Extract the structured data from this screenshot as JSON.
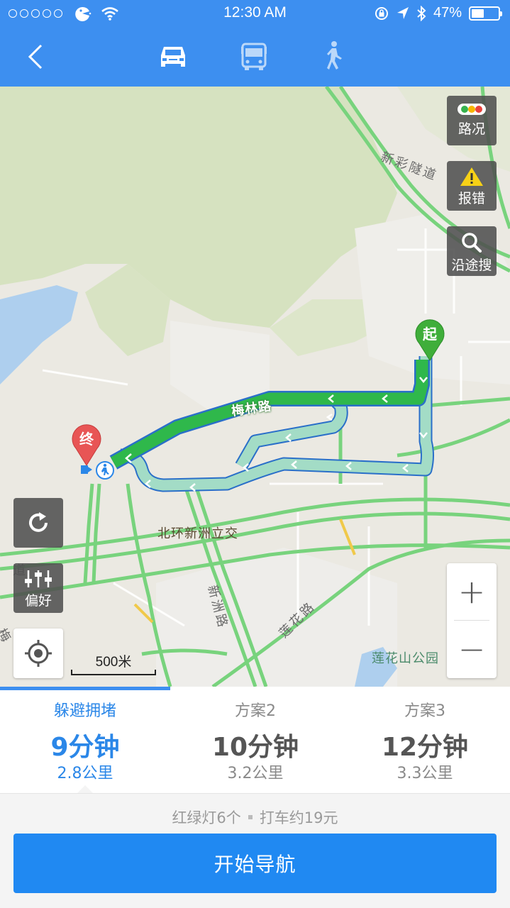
{
  "status_bar": {
    "time": "12:30 AM",
    "battery_percent": "47%",
    "battery_level": 0.47,
    "signal_dots": 5,
    "icons": [
      "signal-dots-icon",
      "carrier-logo-icon",
      "wifi-icon",
      "rotation-lock-icon",
      "location-arrow-icon",
      "bluetooth-icon",
      "battery-icon"
    ]
  },
  "nav": {
    "back_icon": "chevron-left-icon",
    "modes": [
      {
        "name": "car",
        "icon": "car-icon",
        "selected": true
      },
      {
        "name": "bus",
        "icon": "bus-icon",
        "selected": false
      },
      {
        "name": "walk",
        "icon": "walk-icon",
        "selected": false
      }
    ]
  },
  "map": {
    "buttons": {
      "traffic": "路况",
      "report": "报错",
      "search_along": "沿途搜",
      "preference": "偏好"
    },
    "labels": {
      "tunnel": "新彩隧道",
      "meilin_road": "梅林路",
      "interchange": "北环新洲立交",
      "xinzhou_road": "新洲路",
      "lianhua_road": "莲花路",
      "park": "莲花山公园",
      "edge_label_1": "道",
      "edge_label_2": "梅"
    },
    "start_pin": "起",
    "end_pin": "终",
    "scale": "500米",
    "zoom_in": "+",
    "zoom_out": "−",
    "colors": {
      "route_primary": "#2fb84b",
      "route_alt": "#9fd9c2",
      "route_outline": "#2a6fc9",
      "water": "#aed0ee",
      "green_area": "#d7e3c2"
    }
  },
  "routes": [
    {
      "name": "躲避拥堵",
      "time": "9分钟",
      "distance": "2.8公里",
      "selected": true
    },
    {
      "name": "方案2",
      "time": "10分钟",
      "distance": "3.2公里",
      "selected": false
    },
    {
      "name": "方案3",
      "time": "12分钟",
      "distance": "3.3公里",
      "selected": false
    }
  ],
  "summary": {
    "traffic_lights": "红绿灯6个",
    "taxi_fare": "打车约19元"
  },
  "start_button": "开始导航"
}
